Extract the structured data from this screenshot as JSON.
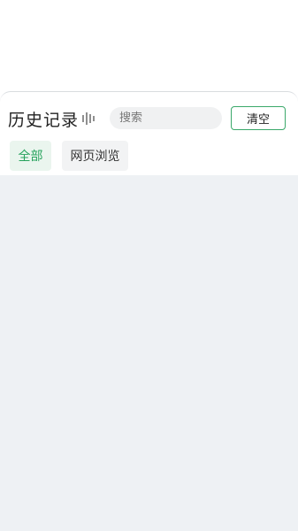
{
  "header": {
    "title": "历史记录",
    "icon": "voice-bars-icon"
  },
  "search": {
    "placeholder": "搜索",
    "value": ""
  },
  "actions": {
    "clear_label": "清空"
  },
  "tabs": [
    {
      "label": "全部",
      "active": true
    },
    {
      "label": "网页浏览",
      "active": false
    }
  ],
  "colors": {
    "accent": "#27a35d",
    "accent_border": "#3aa86a",
    "active_tab_bg": "#eaf5ee",
    "content_bg": "#eef1f4"
  }
}
